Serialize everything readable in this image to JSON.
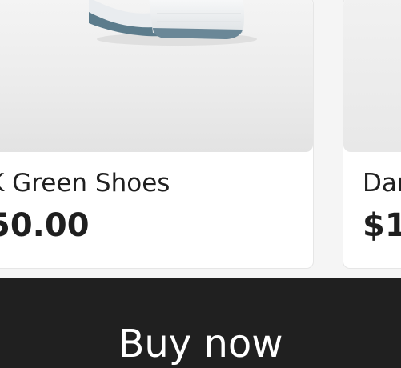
{
  "products": [
    {
      "name": "K Green Shoes",
      "price": "50.00",
      "image_icon": "shoe-image"
    },
    {
      "name": "Dar",
      "price": "$1",
      "image_icon": "product-image"
    }
  ],
  "buy_button": {
    "label": "Buy now",
    "background": "#202020",
    "text_color": "#ffffff"
  }
}
